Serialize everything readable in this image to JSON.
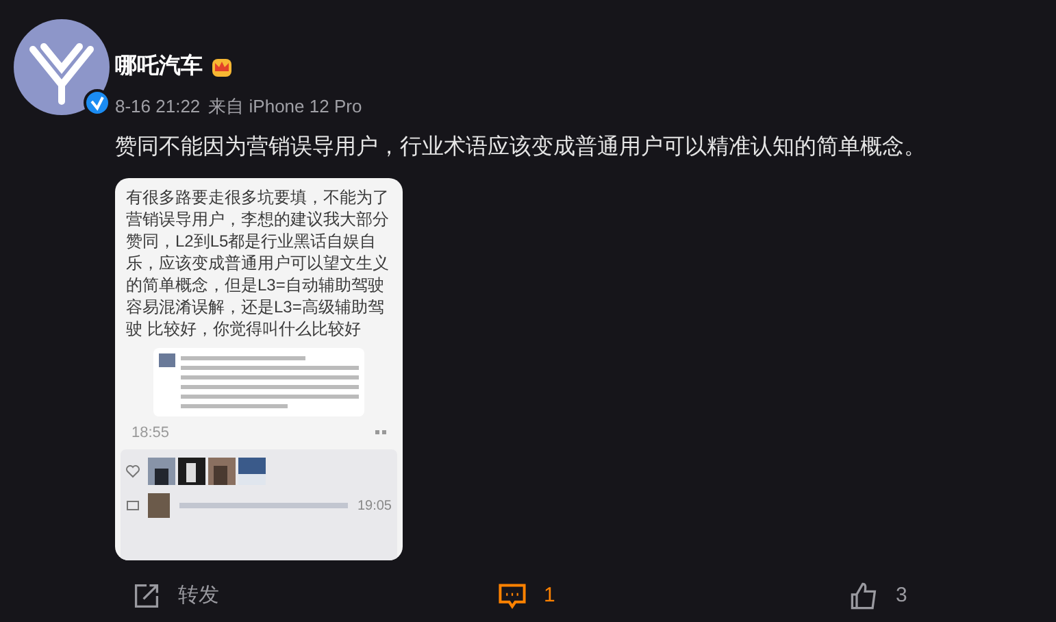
{
  "post": {
    "author": "哪吒汽车",
    "time": "8-16 21:22",
    "source": "来自 iPhone 12 Pro",
    "text": "赞同不能因为营销误导用户，行业术语应该变成普通用户可以精准认知的简单概念。",
    "image": {
      "message": "有很多路要走很多坑要填，不能为了营销误导用户，李想的建议我大部分赞同，L2到L5都是行业黑话自娱自乐，应该变成普通用户可以望文生义的简单概念，但是L3=自动辅助驾驶容易混淆误解，还是L3=高级辅助驾驶 比较好，你觉得叫什么比较好",
      "message_time": "18:55",
      "comment_time": "19:05"
    }
  },
  "actions": [
    {
      "kind": "share",
      "label": "转发",
      "selected": false
    },
    {
      "kind": "comment",
      "label": "1",
      "selected": true
    },
    {
      "kind": "like",
      "label": "3",
      "selected": false
    }
  ]
}
